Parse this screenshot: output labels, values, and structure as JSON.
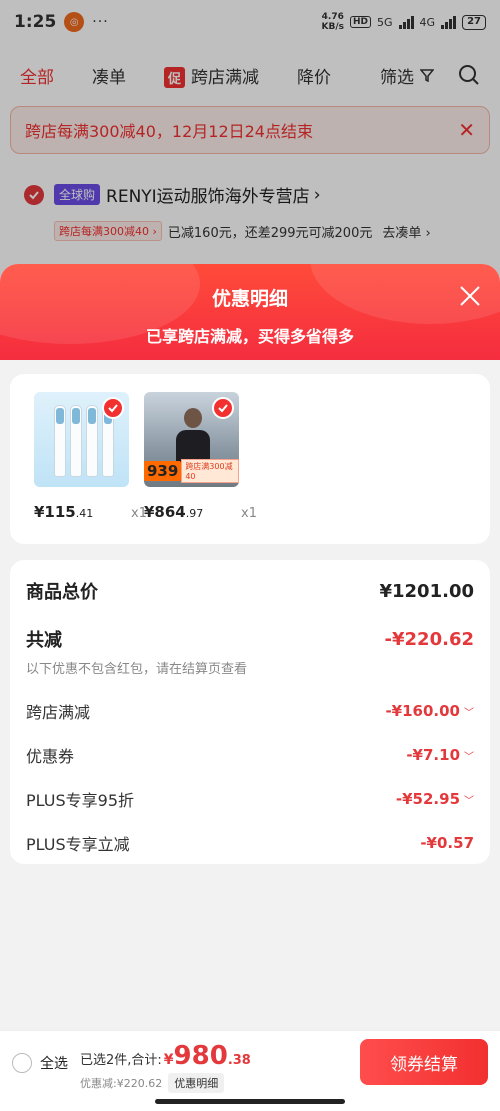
{
  "status": {
    "time": "1:25",
    "net_speed_value": "4.76",
    "net_speed_unit": "KB/s",
    "hd": "HD",
    "net5g": "5G",
    "net4g": "4G",
    "battery": "27"
  },
  "tabs": [
    {
      "label": "全部",
      "active": true
    },
    {
      "label": "凑单"
    },
    {
      "label": "跨店满减",
      "tag": "促"
    },
    {
      "label": "降价"
    }
  ],
  "filter_label": "筛选",
  "banner": {
    "text": "跨店每满300减40，12月12日24点结束"
  },
  "store": {
    "tag": "全球购",
    "name": "RENYI运动服饰海外专营店",
    "promo_tag": "跨店每满300减40",
    "promo_text": "已减160元，还差299元可减200元",
    "promo_link": "去凑单"
  },
  "sheet": {
    "title": "优惠明细",
    "subtitle": "已享跨店满减，买得多省得多"
  },
  "products": [
    {
      "price_int": "¥115",
      "price_dec": ".41",
      "qty": "x1"
    },
    {
      "price_int": "¥864",
      "price_dec": ".97",
      "qty": "x1",
      "thumb_price": "939",
      "thumb_label": "跨店满300减40"
    }
  ],
  "summary": {
    "total_label": "商品总价",
    "total_value": "¥1201.00",
    "reduce_label": "共减",
    "reduce_value": "-¥220.62",
    "note": "以下优惠不包含红包，请在结算页查看",
    "details": [
      {
        "label": "跨店满减",
        "value": "-¥160.00"
      },
      {
        "label": "优惠券",
        "value": "-¥7.10"
      },
      {
        "label": "PLUS专享95折",
        "value": "-¥52.95"
      },
      {
        "label": "PLUS专享立减",
        "value": "-¥0.57"
      }
    ]
  },
  "bottom": {
    "select_all": "全选",
    "selected_text": "已选2件,合计:",
    "yen": "¥",
    "total_int": "980",
    "total_dec": ".38",
    "discount_text": "优惠减:¥220.62",
    "detail_button": "优惠明细",
    "checkout_button": "领券结算"
  },
  "colors": {
    "accent": "#f23030",
    "header_gradient_top": "#ff4b3a",
    "header_gradient_bottom": "#f52d3f"
  }
}
